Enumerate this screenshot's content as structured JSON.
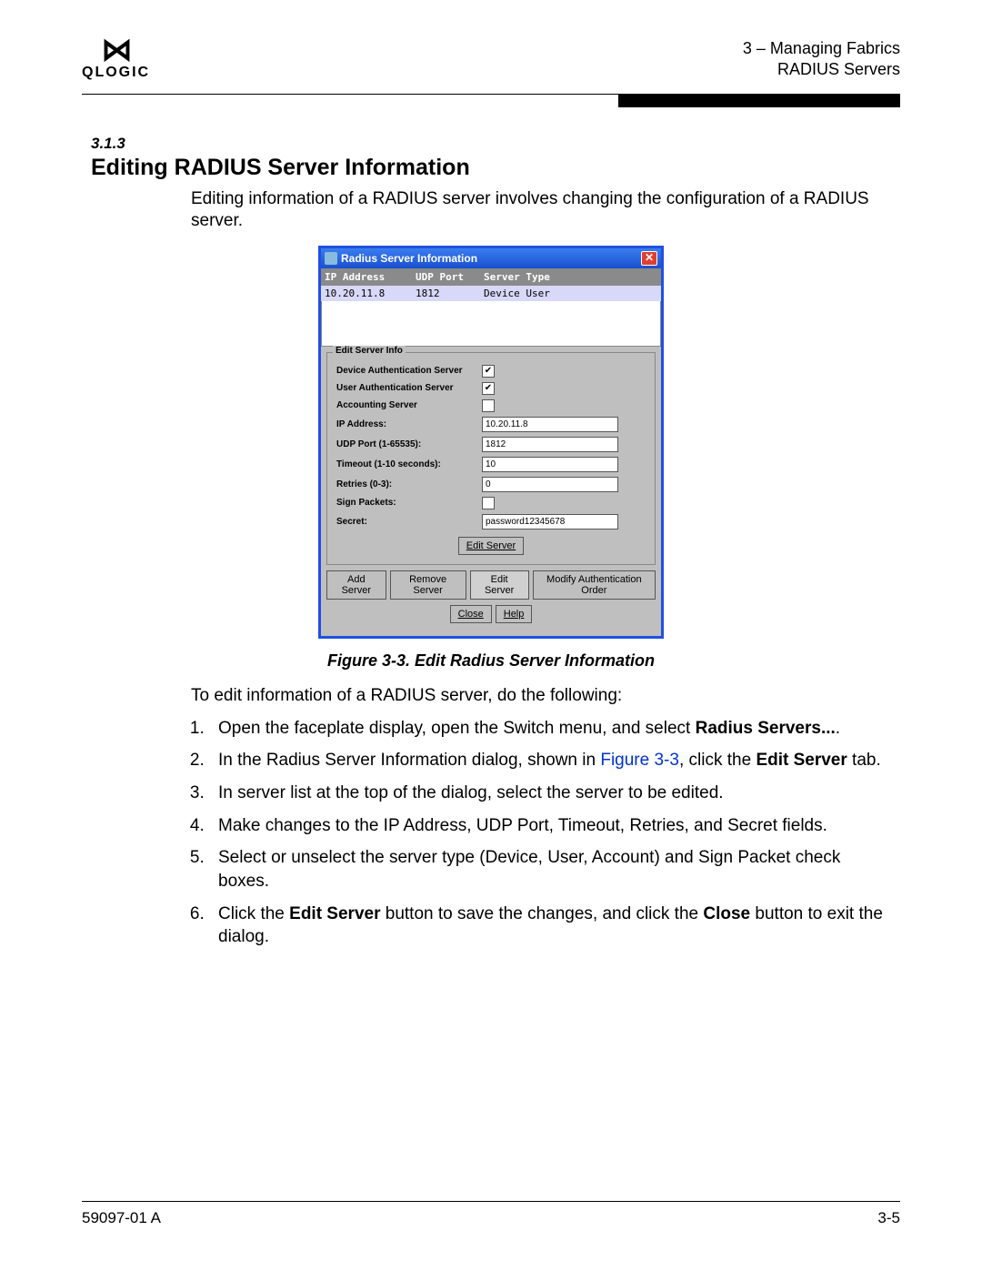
{
  "header": {
    "logo_text": "QLOGIC",
    "chapter_line": "3 – Managing Fabrics",
    "section_line": "RADIUS Servers"
  },
  "section": {
    "number": "3.1.3",
    "title": "Editing RADIUS Server Information",
    "intro": "Editing information of a RADIUS server involves changing the configuration of a RADIUS server."
  },
  "dialog": {
    "title": "Radius Server Information",
    "close_glyph": "✕",
    "columns": {
      "ip": "IP Address",
      "port": "UDP Port",
      "type": "Server Type"
    },
    "row": {
      "ip": "10.20.11.8",
      "port": "1812",
      "type": "Device  User"
    },
    "fieldset_title": "Edit Server Info",
    "fields": {
      "device_label": "Device Authentication Server",
      "device_checked": "✔",
      "user_label": "User Authentication Server",
      "user_checked": "✔",
      "acct_label": "Accounting Server",
      "acct_checked": "",
      "ip_label": "IP Address:",
      "ip_value": "10.20.11.8",
      "udp_label": "UDP Port (1-65535):",
      "udp_value": "1812",
      "timeout_label": "Timeout (1-10 seconds):",
      "timeout_value": "10",
      "retries_label": "Retries (0-3):",
      "retries_value": "0",
      "sign_label": "Sign Packets:",
      "sign_checked": "",
      "secret_label": "Secret:",
      "secret_value": "password12345678"
    },
    "edit_server_btn": "Edit Server",
    "tabs": {
      "add": "Add Server",
      "remove": "Remove Server",
      "edit": "Edit Server",
      "modify": "Modify Authentication Order"
    },
    "bottom_buttons": {
      "close": "Close",
      "help": "Help"
    }
  },
  "figure_caption": "Figure 3-3.  Edit Radius Server Information",
  "instructions": {
    "lead": "To edit information of a RADIUS server, do the following:",
    "step1_a": "Open the faceplate display, open the Switch menu, and select ",
    "step1_b": "Radius Servers...",
    "step1_c": ".",
    "step2_a": "In the Radius Server Information dialog, shown in ",
    "step2_link": "Figure 3-3",
    "step2_b": ", click the ",
    "step2_bold": "Edit Server",
    "step2_c": " tab.",
    "step3": "In server list at the top of the dialog, select the server to be edited.",
    "step4": "Make changes to the IP Address, UDP Port, Timeout, Retries, and Secret fields.",
    "step5": "Select or unselect the server type (Device, User, Account) and Sign Packet check boxes.",
    "step6_a": "Click the ",
    "step6_b1": "Edit Server",
    "step6_b": " button to save the changes, and click the ",
    "step6_b2": "Close",
    "step6_c": " button to exit the dialog."
  },
  "footer": {
    "left": "59097-01 A",
    "right": "3-5"
  }
}
